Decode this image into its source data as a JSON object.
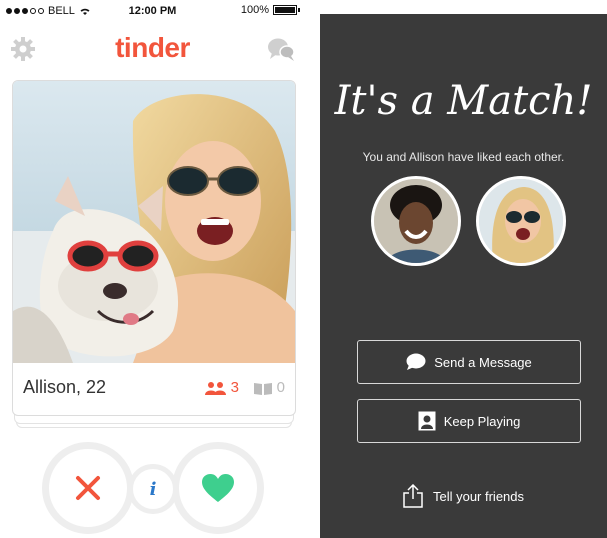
{
  "status_bar": {
    "carrier": "BELL",
    "time": "12:00 PM",
    "battery": "100%",
    "signal_dots_filled": 3,
    "signal_dots_total": 5,
    "battery_level": 1.0
  },
  "navbar": {
    "logo": "tinder",
    "left_icon": "gear-icon",
    "right_icon": "chat-bubbles-icon",
    "accent_color": "#f2553c"
  },
  "card": {
    "name_age": "Allison, 22",
    "shared_friends_count": "3",
    "shared_interests_count": "0",
    "friends_icon": "people-icon",
    "interests_icon": "book-icon"
  },
  "actions": {
    "nope_icon": "x-icon",
    "info_label": "i",
    "like_icon": "heart-icon",
    "nope_color": "#f2553c",
    "info_color": "#2b78c9",
    "like_color": "#3ecf8e"
  },
  "match": {
    "title": "It's a Match!",
    "subtitle": "You and Allison have liked each other.",
    "send_message_label": "Send a Message",
    "keep_playing_label": "Keep Playing",
    "tell_friends_label": "Tell your friends",
    "send_icon": "chat-bubble-icon",
    "keep_icon": "portrait-icon",
    "share_icon": "share-icon",
    "background_color": "#3a3a3a"
  }
}
